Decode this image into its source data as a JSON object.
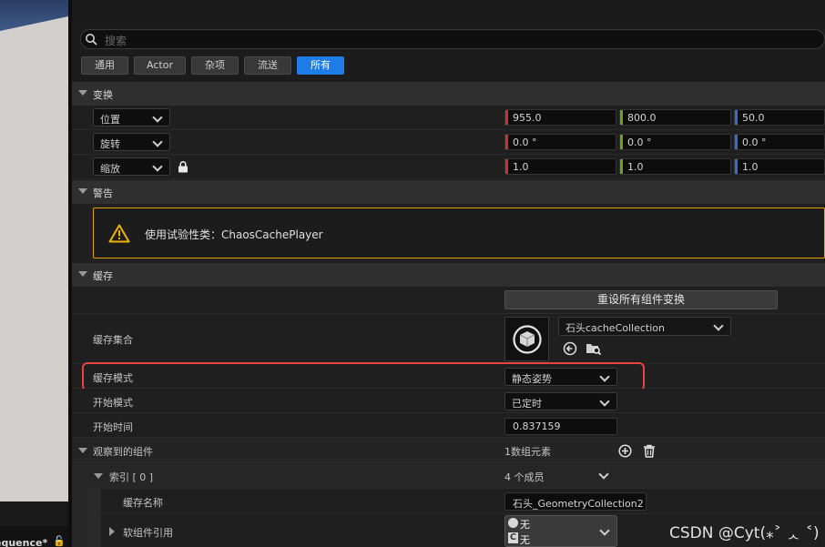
{
  "viewport": {
    "tab_label": "equence*"
  },
  "search": {
    "placeholder": "搜索"
  },
  "filters": [
    "通用",
    "Actor",
    "杂项",
    "流送",
    "所有"
  ],
  "transform": {
    "section": "变换",
    "rows": [
      {
        "mode": "位置",
        "x": "955.0",
        "y": "800.0",
        "z": "50.0"
      },
      {
        "mode": "旋转",
        "x": "0.0 °",
        "y": "0.0 °",
        "z": "0.0 °"
      },
      {
        "mode": "缩放",
        "x": "1.0",
        "y": "1.0",
        "z": "1.0"
      }
    ]
  },
  "warning": {
    "section": "警告",
    "text": "使用试验性类：ChaosCachePlayer"
  },
  "cache": {
    "section": "缓存",
    "reset_button": "重设所有组件变换",
    "collection_label": "缓存集合",
    "collection_value": "石头cacheCollection",
    "mode_label": "缓存模式",
    "mode_value": "静态姿势",
    "start_mode_label": "开始模式",
    "start_mode_value": "已定时",
    "start_time_label": "开始时间",
    "start_time_value": "0.837159",
    "observed_label": "观察到的组件",
    "observed_value": "1数组元素",
    "index_label": "索引 [ 0 ]",
    "index_value": "4 个成员",
    "cache_name_label": "缓存名称",
    "cache_name_value": "石头_GeometryCollection2",
    "soft_ref_label": "软组件引用",
    "soft_ref_line1": "无",
    "soft_ref_line2": "无"
  },
  "watermark": "CSDN @Cyt(⁎˃ ᆺ ˂)",
  "colors": {
    "accent": "#1e7ce6",
    "x_axis": "#c8332f",
    "y_axis": "#6aa11f",
    "z_axis": "#2f6fd6",
    "warning": "#e0a400",
    "highlight": "#e54545"
  }
}
